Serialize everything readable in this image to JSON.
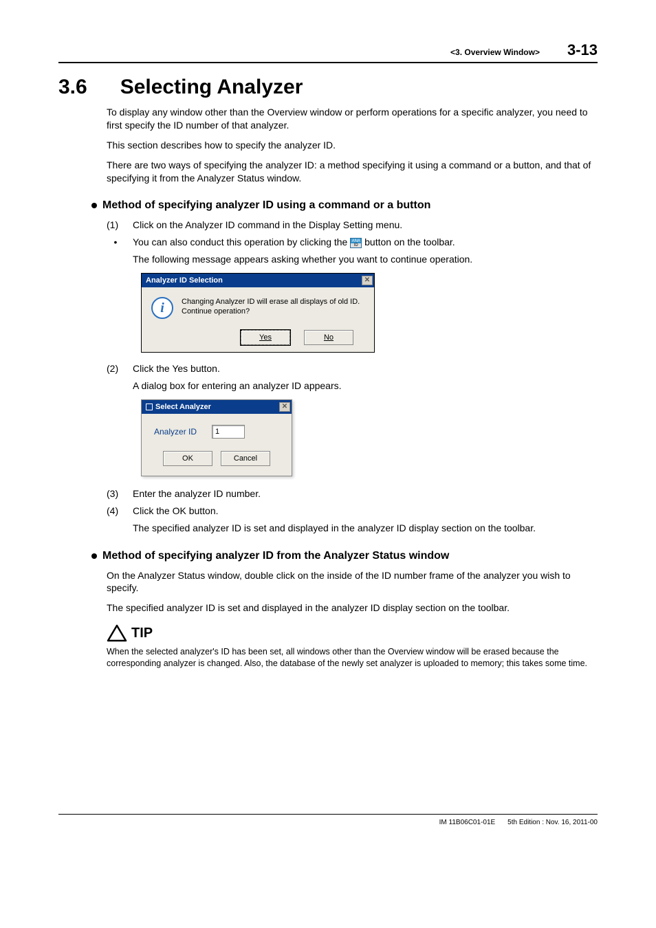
{
  "header": {
    "chapter": "<3.  Overview Window>",
    "page": "3-13"
  },
  "title": {
    "num": "3.6",
    "text": "Selecting Analyzer"
  },
  "intro": {
    "p1": "To display any window other than the Overview window or perform operations for a specific analyzer, you need to first specify the ID number of that analyzer.",
    "p2": "This section describes how to specify the analyzer ID.",
    "p3": "There are two ways of specifying the analyzer ID: a method specifying it using a command or a button, and that of specifying it from the Analyzer Status window."
  },
  "method1": {
    "heading": "Method of specifying analyzer ID using a command or a button",
    "step1_num": "(1)",
    "step1": "Click on the Analyzer ID command in the Display Setting menu.",
    "step1b_pre": "You can also conduct this operation by clicking the ",
    "step1b_post": " button on the toolbar.",
    "step1c": "The following message appears asking whether you want to continue operation.",
    "step2_num": "(2)",
    "step2": "Click the Yes button.",
    "step2b": "A dialog box for entering an analyzer ID appears.",
    "step3_num": "(3)",
    "step3": "Enter the analyzer ID number.",
    "step4_num": "(4)",
    "step4": "Click the OK button.",
    "step4b": "The specified analyzer ID is set and displayed in the analyzer ID display section on the toolbar."
  },
  "dialog1": {
    "title": "Analyzer ID Selection",
    "msg_l1": "Changing Analyzer ID will erase all displays of old ID.",
    "msg_l2": "Continue operation?",
    "yes": "Yes",
    "no": "No"
  },
  "dialog2": {
    "title": "Select Analyzer",
    "label": "Analyzer ID",
    "value": "1",
    "ok": "OK",
    "cancel": "Cancel"
  },
  "method2": {
    "heading": "Method of specifying analyzer ID from the Analyzer Status window",
    "p1": "On the Analyzer Status window, double click on the inside of the ID number frame of the analyzer you wish to specify.",
    "p2": "The specified analyzer ID is set and displayed in the analyzer ID display section on the toolbar."
  },
  "tip": {
    "label": "TIP",
    "text": "When the selected analyzer's ID has been set, all windows other than the Overview window will be erased because the corresponding analyzer is changed. Also, the database of the newly set analyzer is uploaded to memory; this takes some time."
  },
  "footer": {
    "doc": "IM 11B06C01-01E",
    "edition": "5th Edition : Nov. 16, 2011-00"
  }
}
